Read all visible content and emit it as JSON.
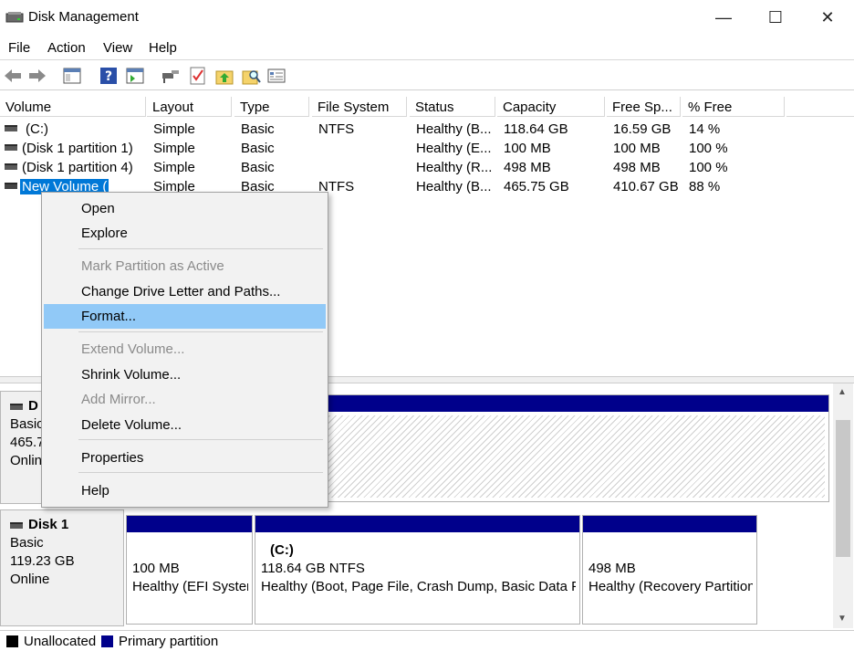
{
  "window": {
    "title": "Disk Management",
    "minimize": "—",
    "maximize": "☐",
    "close": "✕"
  },
  "menu": [
    "File",
    "Action",
    "View",
    "Help"
  ],
  "columns": [
    "Volume",
    "Layout",
    "Type",
    "File System",
    "Status",
    "Capacity",
    "Free Sp...",
    "% Free"
  ],
  "volumes": [
    {
      "volume": "(C:)",
      "layout": "Simple",
      "type": "Basic",
      "fs": "NTFS",
      "status": "Healthy (B...",
      "capacity": "118.64 GB",
      "free": "16.59 GB",
      "pct": "14 %"
    },
    {
      "volume": "(Disk 1 partition 1)",
      "layout": "Simple",
      "type": "Basic",
      "fs": "",
      "status": "Healthy (E...",
      "capacity": "100 MB",
      "free": "100 MB",
      "pct": "100 %"
    },
    {
      "volume": "(Disk 1 partition 4)",
      "layout": "Simple",
      "type": "Basic",
      "fs": "",
      "status": "Healthy (R...",
      "capacity": "498 MB",
      "free": "498 MB",
      "pct": "100 %"
    },
    {
      "volume": "New Volume (",
      "layout": "Simple",
      "type": "Basic",
      "fs": "NTFS",
      "status": "Healthy (B...",
      "capacity": "465.75 GB",
      "free": "410.67 GB",
      "pct": "88 %"
    }
  ],
  "context_menu": {
    "open": "Open",
    "explore": "Explore",
    "mark_active": "Mark Partition as Active",
    "change_letter": "Change Drive Letter and Paths...",
    "format": "Format...",
    "extend": "Extend Volume...",
    "shrink": "Shrink Volume...",
    "add_mirror": "Add Mirror...",
    "delete": "Delete Volume...",
    "properties": "Properties",
    "help": "Help"
  },
  "disk0": {
    "name": "D",
    "type": "Basic",
    "size": "465.7",
    "status": "Onlin"
  },
  "disk1": {
    "name": "Disk 1",
    "type": "Basic",
    "size": "119.23 GB",
    "status": "Online",
    "partitions": [
      {
        "title": "",
        "line1": "100 MB",
        "line2": "Healthy (EFI System Partition)"
      },
      {
        "title": "(C:)",
        "line1": "118.64 GB NTFS",
        "line2": "Healthy (Boot, Page File, Crash Dump, Basic Data Partition)"
      },
      {
        "title": "",
        "line1": "498 MB",
        "line2": "Healthy (Recovery Partition)"
      }
    ]
  },
  "legend": {
    "unallocated": "Unallocated",
    "primary": "Primary partition",
    "unallocated_color": "#000000",
    "primary_color": "#00008b"
  },
  "colors": {
    "selection": "#0078d7",
    "menu_highlight": "#91c9f7",
    "partition_bar": "#00008b"
  }
}
